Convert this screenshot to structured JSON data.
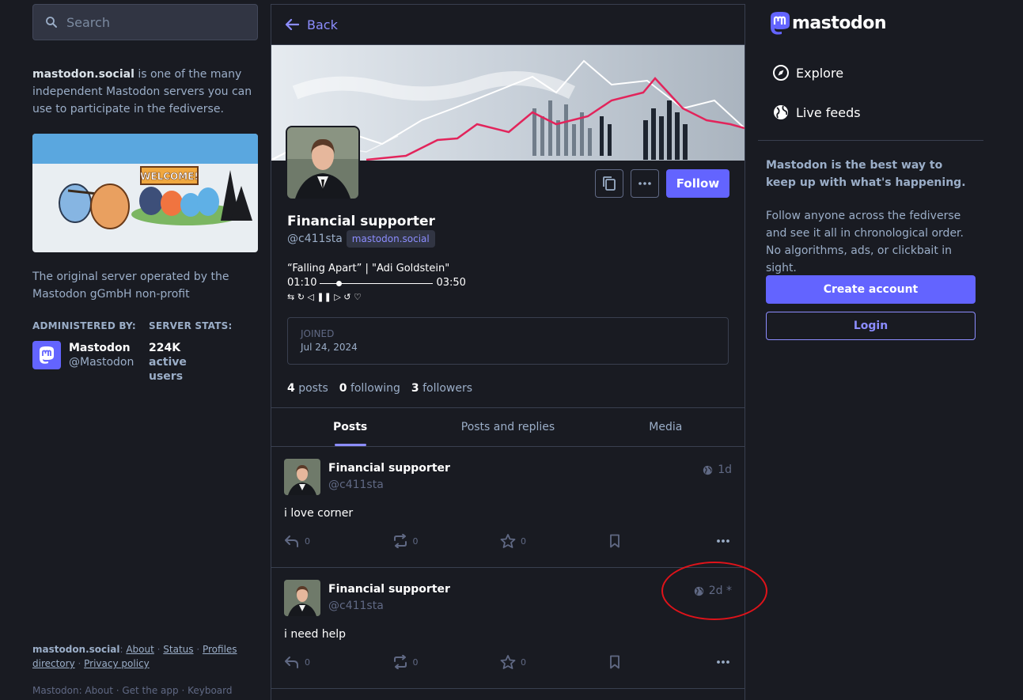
{
  "search": {
    "placeholder": "Search"
  },
  "server": {
    "name": "mastodon.social",
    "intro_rest": " is one of the many independent Mastodon servers you can use to participate in the fediverse.",
    "hero_sign": "WELCOME!",
    "description": "The original server operated by the Mastodon gGmbH non-profit",
    "administered_by_label": "ADMINISTERED BY:",
    "server_stats_label": "SERVER STATS:",
    "admin": {
      "name": "Mastodon",
      "handle": "@Mastodon"
    },
    "stats": {
      "value": "224K",
      "label": "active users"
    }
  },
  "footer": {
    "server": "mastodon.social",
    "links": [
      "About",
      "Status",
      "Profiles directory",
      "Privacy policy"
    ],
    "sep": " · ",
    "cutoff": "Mastodon: About · Get the app · Keyboard"
  },
  "profile": {
    "back_label": "Back",
    "display_name": "Financial supporter",
    "handle": "@c411sta",
    "domain": "mastodon.social",
    "follow_label": "Follow",
    "bio_line": "“Falling Apart” | \"Adi Goldstein\"",
    "player_start": "01:10",
    "player_end": "03:50",
    "player_controls": "⇆ ↻ ◁ ❚❚ ▷ ↺ ♡",
    "joined_label": "JOINED",
    "joined_date": "Jul 24, 2024",
    "counts": {
      "posts_num": "4",
      "posts_label": "posts",
      "following_num": "0",
      "following_label": "following",
      "followers_num": "3",
      "followers_label": "followers"
    }
  },
  "tabs": [
    "Posts",
    "Posts and replies",
    "Media"
  ],
  "posts": [
    {
      "name": "Financial supporter",
      "handle": "@c411sta",
      "time": "1d",
      "content": "i love corner",
      "replies": "0",
      "boosts": "0",
      "favs": "0"
    },
    {
      "name": "Financial supporter",
      "handle": "@c411sta",
      "time": "2d *",
      "content": "i need help",
      "replies": "0",
      "boosts": "0",
      "favs": "0"
    }
  ],
  "right": {
    "logo_text": "mastodon",
    "nav": [
      "Explore",
      "Live feeds"
    ],
    "cta_title": "Mastodon is the best way to keep up with what's happening.",
    "cta_text": "Follow anyone across the fediverse and see it all in chronological order. No algorithms, ads, or clickbait in sight.",
    "create_label": "Create account",
    "login_label": "Login"
  },
  "colors": {
    "accent": "#6364ff",
    "accent_light": "#8c8dff",
    "bg": "#191b22",
    "annotation": "#e0131a"
  }
}
